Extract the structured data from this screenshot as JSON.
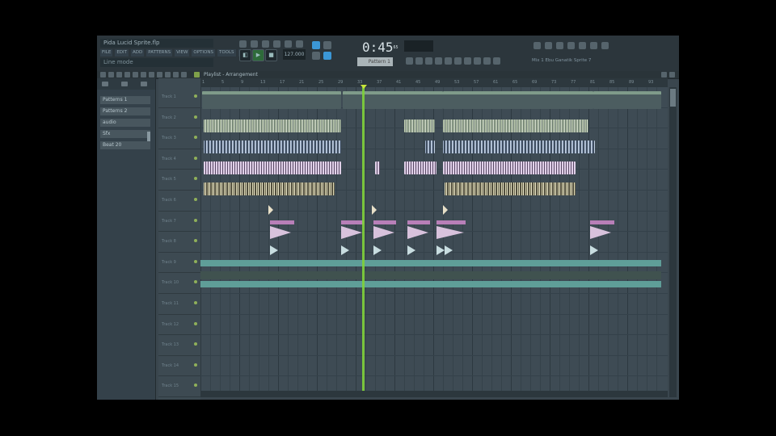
{
  "window": {
    "title": "Pida Lucid Sprite.flp",
    "hint": "Line mode"
  },
  "menu": [
    "FILE",
    "EDIT",
    "ADD",
    "PATTERNS",
    "VIEW",
    "OPTIONS",
    "TOOLS",
    "?"
  ],
  "transport": {
    "tempo": "127.000",
    "time": "0:45",
    "time_suffix": "65",
    "pattern": "Pattern 1"
  },
  "hint_right": "Mix 1 Ebu Ganatik Sprite 7",
  "playlist": {
    "title": "Playlist - Arrangement"
  },
  "browser": {
    "items": [
      "Patterns 1",
      "Patterns 2",
      "audio",
      "Sfx",
      "Beat 20"
    ]
  },
  "ruler": {
    "ticks": [
      "1",
      "5",
      "9",
      "13",
      "17",
      "21",
      "25",
      "29",
      "33",
      "37",
      "41",
      "45",
      "49",
      "53",
      "57",
      "61",
      "65",
      "69",
      "73",
      "77",
      "81",
      "85",
      "89",
      "93"
    ]
  },
  "tracks": [
    "Track 1",
    "Track 2",
    "Track 3",
    "Track 4",
    "Track 5",
    "Track 6",
    "Track 7",
    "Track 8",
    "Track 9",
    "Track 10",
    "Track 11",
    "Track 12",
    "Track 13",
    "Track 14",
    "Track 15"
  ],
  "colors": {
    "accent": "#3b97d6",
    "playhead": "#7fd23a",
    "automation": "#5f9e98",
    "clip_pink": "#b87fb8"
  }
}
